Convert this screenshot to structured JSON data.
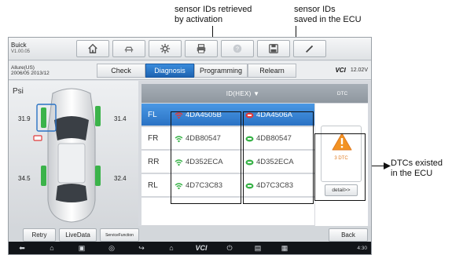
{
  "annotations": {
    "retrieved": [
      "sensor IDs retrieved",
      "by activation"
    ],
    "saved": [
      "sensor IDs",
      "saved in the ECU"
    ],
    "dtcs": [
      "DTCs existed",
      "in the ECU"
    ]
  },
  "vehicle": {
    "make": "Buick",
    "version": "V1.00.05",
    "model": "Allure(US)",
    "years": "2006/05 2013/12"
  },
  "toolbar": {
    "buttons": [
      "home-icon",
      "car-swap-icon",
      "settings-icon",
      "print-icon",
      "help-icon",
      "save-icon",
      "edit-icon"
    ]
  },
  "tabs": {
    "items": [
      "Check",
      "Diagnosis",
      "Programming",
      "Relearn"
    ],
    "active": "Diagnosis"
  },
  "vci": {
    "label": "VCI",
    "voltage": "12.02V"
  },
  "pressure": {
    "unit": "Psi",
    "fl": "31.9",
    "fr": "31.4",
    "rl": "34.5",
    "rr": "32.4"
  },
  "table": {
    "id_header": "ID(HEX) ▼",
    "dtc_header": "DTC",
    "rows": [
      {
        "pos": "FL",
        "retrieved": "4DA4505B",
        "saved": "4DA4506A",
        "selected": true
      },
      {
        "pos": "FR",
        "retrieved": "4DB80547",
        "saved": "4DB80547",
        "selected": false
      },
      {
        "pos": "RR",
        "retrieved": "4D352ECA",
        "saved": "4D352ECA",
        "selected": false
      },
      {
        "pos": "RL",
        "retrieved": "4D7C3C83",
        "saved": "4D7C3C83",
        "selected": false
      }
    ],
    "dtc_count": "3 DTC",
    "detail_label": "detail>>"
  },
  "bottom": {
    "retry": "Retry",
    "livedata": "LiveData",
    "service": "ServiceFunction",
    "back": "Back"
  },
  "system": {
    "time": "4:30"
  },
  "colors": {
    "accent": "#2a72c4",
    "warning": "#f29222",
    "sensor_ok": "#3bb34a",
    "sensor_mismatch": "#e03a3a"
  }
}
